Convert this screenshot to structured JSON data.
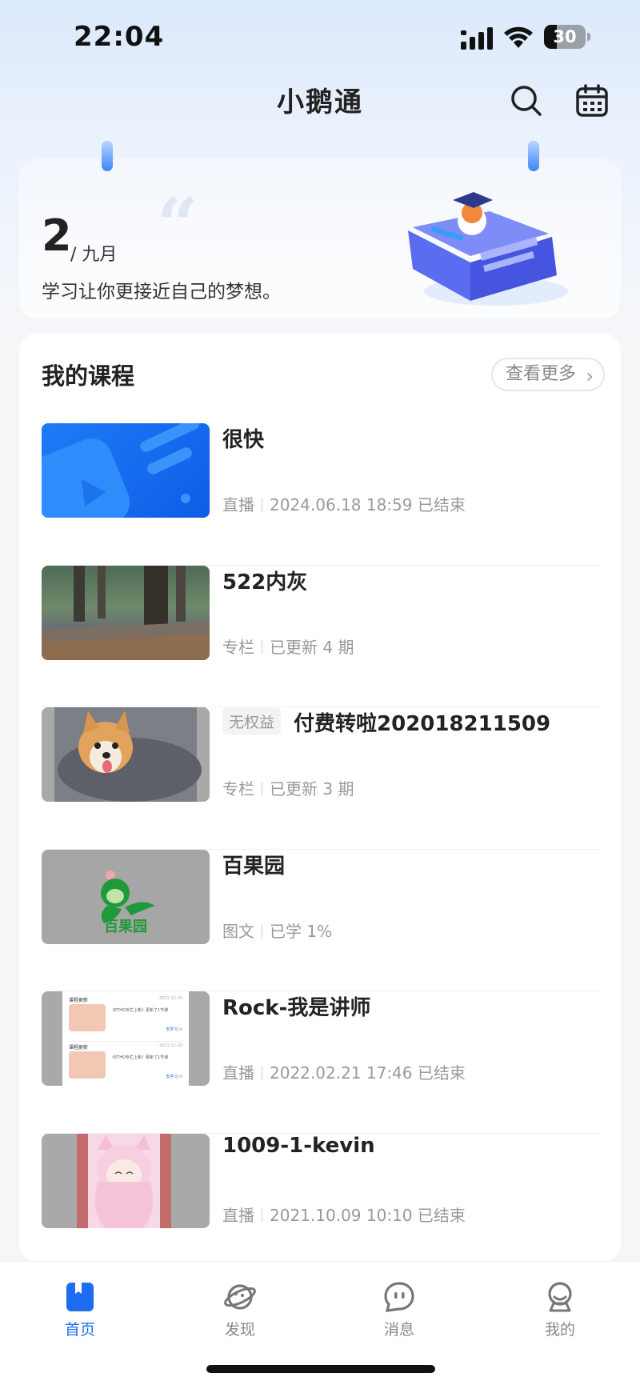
{
  "status_bar": {
    "time": "22:04",
    "battery": "30",
    "battery_level": 0.3
  },
  "header": {
    "title": "小鹅通",
    "search_icon": "search-icon",
    "calendar_icon": "calendar-icon"
  },
  "banner": {
    "day": "2",
    "month": "/ 九月",
    "motto": "学习让你更接近自己的梦想。"
  },
  "courses": {
    "section_title": "我的课程",
    "more_label": "查看更多",
    "items": [
      {
        "title": "很快",
        "type": "直播",
        "status": "2024.06.18 18:59 已结束"
      },
      {
        "title": "522内灰",
        "type": "专栏",
        "status": "已更新 4 期"
      },
      {
        "tag": "无权益",
        "title": "付费转啦202018211509",
        "type": "专栏",
        "status": "已更新 3 期"
      },
      {
        "title": "百果园",
        "type": "图文",
        "status": "已学 1%",
        "thumb_text": "百果园"
      },
      {
        "title": "Rock-我是讲师",
        "type": "直播",
        "status": "2022.02.21 17:46 已结束",
        "thumb_notice": {
          "label": "课程更新",
          "date": "2021-12-20",
          "text": "《ETHO专栏上新》更新了1节课",
          "action": "去学习 >"
        }
      },
      {
        "title": "1009-1-kevin",
        "type": "直播",
        "status": "2021.10.09 10:10 已结束"
      }
    ]
  },
  "tab_bar": {
    "tabs": [
      {
        "label": "首页",
        "active": true,
        "icon": "home-book-icon"
      },
      {
        "label": "发现",
        "active": false,
        "icon": "planet-icon"
      },
      {
        "label": "消息",
        "active": false,
        "icon": "message-bubble-icon"
      },
      {
        "label": "我的",
        "active": false,
        "icon": "profile-icon"
      }
    ]
  },
  "colors": {
    "accent": "#1e6cf2",
    "text_primary": "#222222",
    "text_secondary": "#999999"
  }
}
